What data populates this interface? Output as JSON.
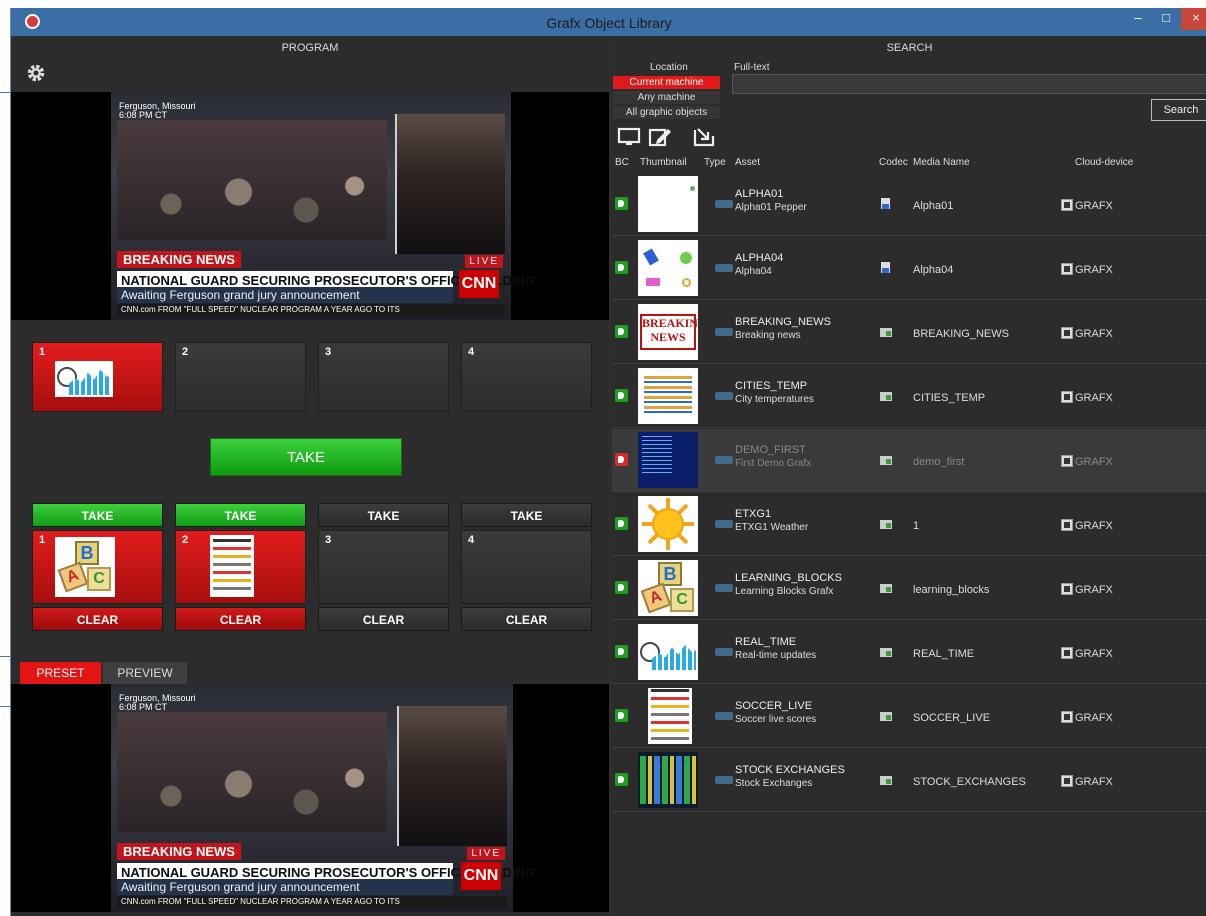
{
  "window": {
    "title": "Grafx Object Library",
    "minimize": "–",
    "maximize": "□",
    "close": "×"
  },
  "program": {
    "header": "PROGRAM",
    "video": {
      "location": "Ferguson, Missouri",
      "time": "6:08 PM CT",
      "breaking": "BREAKING NEWS",
      "live": "LIVE",
      "headline": "NATIONAL GUARD SECURING PROSECUTOR'S OFFICE BUILDING",
      "subline": "Awaiting Ferguson grand jury announcement",
      "network": "CNN",
      "ticker": "CNN.com  FROM \"FULL SPEED\" NUCLEAR PROGRAM A YEAR AGO TO ITS"
    },
    "top_slots": [
      "1",
      "2",
      "3",
      "4"
    ],
    "take_main": "TAKE",
    "take_buttons": [
      "TAKE",
      "TAKE",
      "TAKE",
      "TAKE"
    ],
    "mid_slots": [
      "1",
      "2",
      "3",
      "4"
    ],
    "clear_buttons": [
      "CLEAR",
      "CLEAR",
      "CLEAR",
      "CLEAR"
    ],
    "tabs": {
      "preset": "PRESET",
      "preview": "PREVIEW"
    }
  },
  "search": {
    "header": "SEARCH",
    "location_label": "Location",
    "fulltext_label": "Full-text",
    "location_options": [
      "Current machine",
      "Any machine",
      "All graphic objects"
    ],
    "fulltext_value": "",
    "search_button": "Search",
    "columns": {
      "bc": "BC",
      "thumbnail": "Thumbnail",
      "type": "Type",
      "asset": "Asset",
      "codec": "Codec",
      "media": "Media Name",
      "cloud": "Cloud-device"
    },
    "rows": [
      {
        "asset": "ALPHA01",
        "desc": "Alpha01 Pepper",
        "media": "Alpha01",
        "cloud": "GRAFX"
      },
      {
        "asset": "ALPHA04",
        "desc": "Alpha04",
        "media": "Alpha04",
        "cloud": "GRAFX"
      },
      {
        "asset": "BREAKING_NEWS",
        "desc": "Breaking news",
        "media": "BREAKING_NEWS",
        "cloud": "GRAFX",
        "thumb_text": "BREAKING NEWS"
      },
      {
        "asset": "CITIES_TEMP",
        "desc": "City temperatures",
        "media": "CITIES_TEMP",
        "cloud": "GRAFX"
      },
      {
        "asset": "DEMO_FIRST",
        "desc": "First Demo Grafx",
        "media": "demo_first",
        "cloud": "GRAFX"
      },
      {
        "asset": "ETXG1",
        "desc": "ETXG1 Weather",
        "media": "1",
        "cloud": "GRAFX"
      },
      {
        "asset": "LEARNING_BLOCKS",
        "desc": "Learning Blocks Grafx",
        "media": "learning_blocks",
        "cloud": "GRAFX"
      },
      {
        "asset": "REAL_TIME",
        "desc": "Real-time updates",
        "media": "REAL_TIME",
        "cloud": "GRAFX"
      },
      {
        "asset": "SOCCER_LIVE",
        "desc": "Soccer live scores",
        "media": "SOCCER_LIVE",
        "cloud": "GRAFX"
      },
      {
        "asset": "STOCK EXCHANGES",
        "desc": "Stock Exchanges",
        "media": "STOCK_EXCHANGES",
        "cloud": "GRAFX"
      }
    ]
  },
  "colors": {
    "accent_red": "#e21c1c",
    "take_green": "#2bbf2b",
    "title_bar": "#3b6ea5",
    "panel_bg": "#2c2c2c"
  }
}
